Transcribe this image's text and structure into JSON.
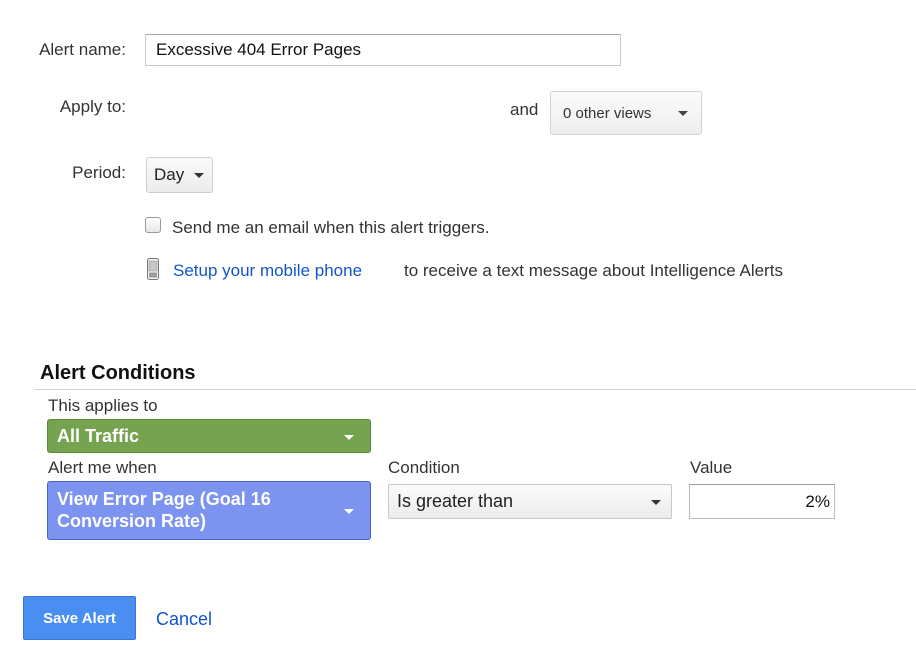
{
  "form": {
    "alert_name_label": "Alert name:",
    "alert_name_value": "Excessive 404 Error Pages",
    "apply_to_label": "Apply to:",
    "and_text": "and",
    "views_dropdown_value": "0 other views",
    "period_label": "Period:",
    "period_value": "Day",
    "email_checkbox_checked": false,
    "email_checkbox_label": "Send me an email when this alert triggers.",
    "setup_link_text": "Setup your mobile phone",
    "setup_rest_text": "to receive a text message about Intelligence Alerts"
  },
  "conditions": {
    "section_title": "Alert Conditions",
    "applies_to_label": "This applies to",
    "applies_to_value": "All Traffic",
    "alert_me_when_label": "Alert me when",
    "alert_me_when_value": "View Error Page (Goal 16 Conversion Rate)",
    "condition_label": "Condition",
    "condition_value": "Is greater than",
    "value_label": "Value",
    "value_value": "2%"
  },
  "actions": {
    "save_label": "Save Alert",
    "cancel_label": "Cancel"
  },
  "colors": {
    "link": "#1155cc",
    "segment_green": "#76a34f",
    "metric_blue": "#7c93f0",
    "primary_button": "#4b8ef1"
  },
  "icons": {
    "caret": "chevron-down-icon",
    "phone": "mobile-phone-icon"
  }
}
